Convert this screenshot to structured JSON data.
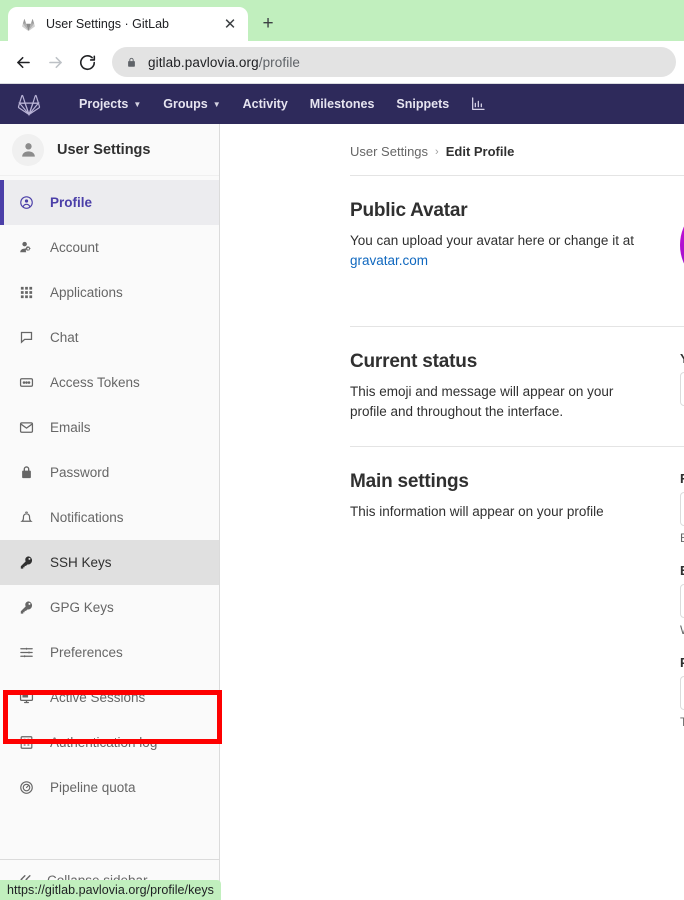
{
  "browser": {
    "tab": {
      "title": "User Settings · GitLab",
      "favicon": "gitlab-tanuki-favicon",
      "close_label": "✕"
    },
    "new_tab_label": "+",
    "nav": {
      "back_label": "←",
      "forward_label": "→",
      "reload_label": "⟳"
    },
    "omnibox": {
      "lock_icon": "lock-icon",
      "host": "gitlab.pavlovia.org",
      "path": "/profile"
    },
    "status_bar": {
      "url": "https://gitlab.pavlovia.org/profile/keys"
    },
    "colors": {
      "tabstrip": "#c1efbe",
      "omnibox": "#e3e3e3"
    }
  },
  "gitlab": {
    "navbar": {
      "logo": "gitlab-tanuki-logo",
      "items": [
        {
          "label": "Projects",
          "has_caret": true
        },
        {
          "label": "Groups",
          "has_caret": true
        },
        {
          "label": "Activity",
          "has_caret": false
        },
        {
          "label": "Milestones",
          "has_caret": false
        },
        {
          "label": "Snippets",
          "has_caret": false
        }
      ],
      "chart_icon": "analytics-chart-icon",
      "background": "#2e2a5b"
    },
    "sidebar": {
      "user": {
        "name": "User Settings",
        "avatar_icon": "user-avatar-icon"
      },
      "items": [
        {
          "label": "Profile",
          "icon": "profile-circle-icon",
          "state": "active"
        },
        {
          "label": "Account",
          "icon": "account-gear-icon",
          "state": "normal"
        },
        {
          "label": "Applications",
          "icon": "applications-grid-icon",
          "state": "normal"
        },
        {
          "label": "Chat",
          "icon": "chat-bubble-icon",
          "state": "normal"
        },
        {
          "label": "Access Tokens",
          "icon": "access-token-card-icon",
          "state": "normal"
        },
        {
          "label": "Emails",
          "icon": "envelope-icon",
          "state": "normal"
        },
        {
          "label": "Password",
          "icon": "lock-icon",
          "state": "normal"
        },
        {
          "label": "Notifications",
          "icon": "bell-icon",
          "state": "normal"
        },
        {
          "label": "SSH Keys",
          "icon": "key-icon",
          "state": "hover"
        },
        {
          "label": "GPG Keys",
          "icon": "key-icon",
          "state": "normal"
        },
        {
          "label": "Preferences",
          "icon": "sliders-icon",
          "state": "normal"
        },
        {
          "label": "Active Sessions",
          "icon": "monitor-icon",
          "state": "normal"
        },
        {
          "label": "Authentication log",
          "icon": "log-list-icon",
          "state": "normal"
        },
        {
          "label": "Pipeline quota",
          "icon": "quota-gauge-icon",
          "state": "normal"
        }
      ],
      "collapse": {
        "label": "Collapse sidebar",
        "icon": "double-chevron-left-icon"
      },
      "highlight_annotation": {
        "target_label": "SSH Keys",
        "color": "#fe0000"
      }
    },
    "breadcrumb": {
      "parent": "User Settings",
      "separator": "›",
      "current": "Edit Profile"
    },
    "sections": [
      {
        "title": "Public Avatar",
        "description_pre": "You can upload your avatar here or change it at ",
        "link_text": "gravatar.com"
      },
      {
        "title": "Current status",
        "description": "This emoji and message will appear on your profile and throughout the interface."
      },
      {
        "title": "Main settings",
        "description": "This information will appear on your profile"
      }
    ],
    "fields": [
      {
        "label": "Y",
        "hint": ""
      },
      {
        "label": "F",
        "hint": "E"
      },
      {
        "label": "E",
        "hint": "W"
      },
      {
        "label": "P",
        "hint": "T"
      }
    ]
  }
}
